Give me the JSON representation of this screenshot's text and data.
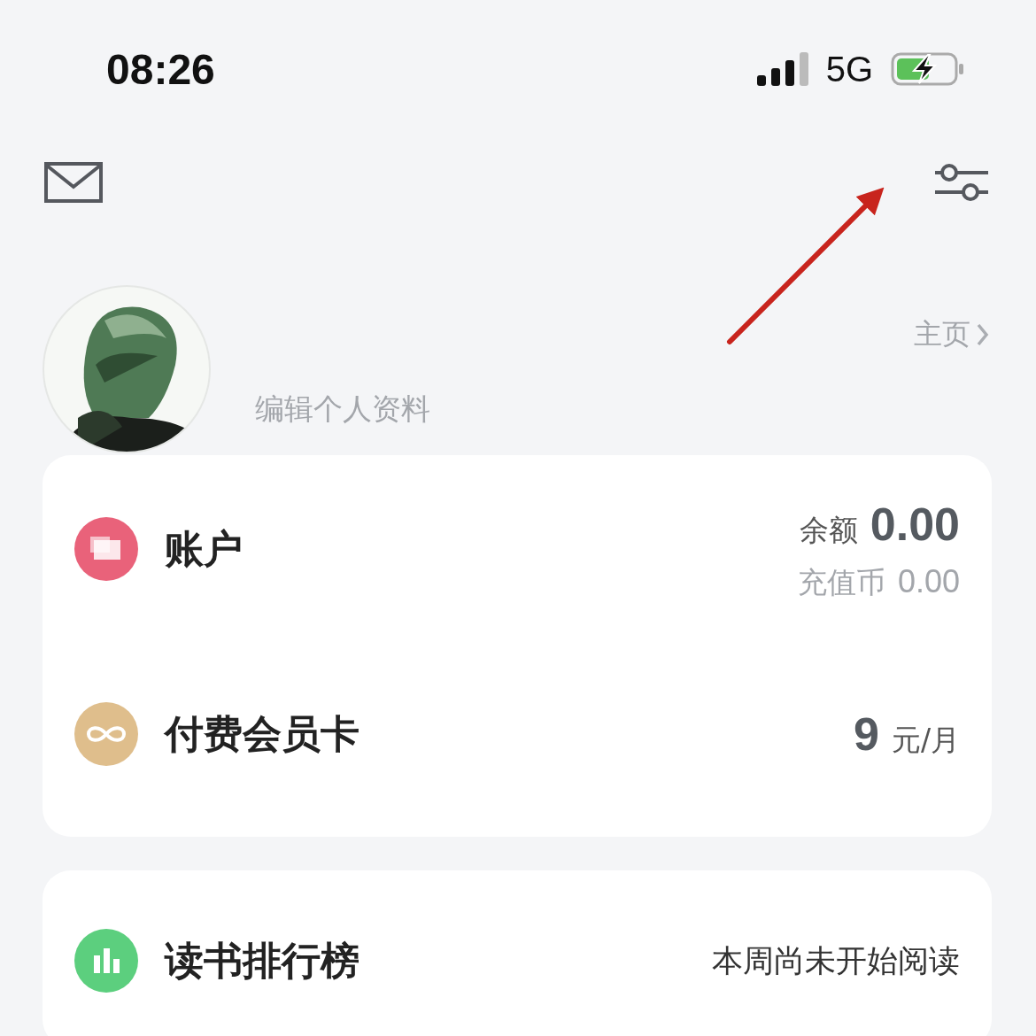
{
  "status_bar": {
    "time": "08:26",
    "network": "5G",
    "charging": true
  },
  "profile": {
    "edit_label": "编辑个人资料",
    "homepage_link": "主页"
  },
  "cards": [
    {
      "rows": [
        {
          "kind": "account",
          "title": "账户",
          "color": "#e9627a",
          "balance_label": "余额",
          "balance": "0.00",
          "sub_label": "充值币",
          "sub_value": "0.00"
        },
        {
          "kind": "membership",
          "title": "付费会员卡",
          "color": "#dfbe8c",
          "price": "9",
          "unit": "元/月"
        }
      ]
    },
    {
      "rows": [
        {
          "kind": "ranking",
          "title": "读书排行榜",
          "color": "#5ccf7e",
          "status": "本周尚未开始阅读"
        }
      ]
    }
  ]
}
